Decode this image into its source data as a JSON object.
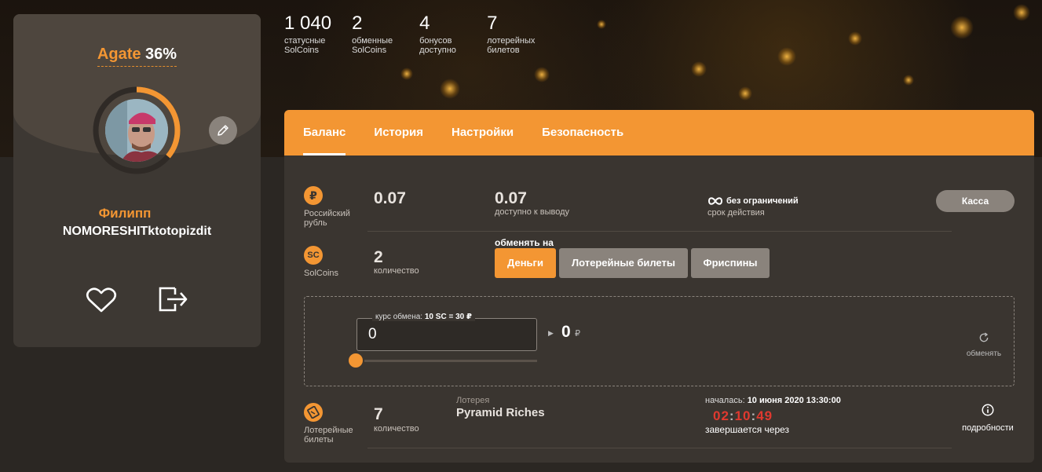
{
  "profile": {
    "rank_name": "Agate",
    "rank_percent": "36%",
    "rank_progress": 0.36,
    "first_name": "Филипп",
    "username": "NOMORESHITktotopizdit"
  },
  "stats": [
    {
      "value": "1 040",
      "label": "статусные SolCoins"
    },
    {
      "value": "2",
      "label": "обменные SolCoins"
    },
    {
      "value": "4",
      "label": "бонусов доступно"
    },
    {
      "value": "7",
      "label": "лотерейных билетов"
    }
  ],
  "tabs": [
    {
      "label": "Баланс",
      "active": true
    },
    {
      "label": "История",
      "active": false
    },
    {
      "label": "Настройки",
      "active": false
    },
    {
      "label": "Безопасность",
      "active": false
    }
  ],
  "ruble": {
    "icon_symbol": "₽",
    "name": "Российский рубль",
    "balance": "0.07",
    "available": "0.07",
    "available_label": "доступно к выводу",
    "validity": "без ограничений",
    "validity_label": "срок действия",
    "cashier_label": "Касса"
  },
  "solcoins": {
    "icon_symbol": "SC",
    "name": "SolCoins",
    "count": "2",
    "count_label": "количество",
    "exchange_to_label": "обменять на",
    "options": [
      "Деньги",
      "Лотерейные билеты",
      "Фриспины"
    ]
  },
  "exchange": {
    "rate_prefix": "курс обмена:",
    "rate_value": "10 SC = 30 ₽",
    "input_value": "0",
    "result_value": "0",
    "result_currency": "₽",
    "action_label": "обменять"
  },
  "lottery": {
    "name": "Лотерейные билеты",
    "count": "7",
    "count_label": "количество",
    "title_label": "Лотерея",
    "title": "Pyramid Riches",
    "started_label": "началась:",
    "started_at": "10 июня 2020 13:30:00",
    "timer_h": "02",
    "timer_m": "10",
    "timer_s": "49",
    "ends_label": "завершается через",
    "details_label": "подробности"
  },
  "colors": {
    "accent": "#f39633",
    "panel": "#3a3530",
    "timer": "#e0392f"
  }
}
